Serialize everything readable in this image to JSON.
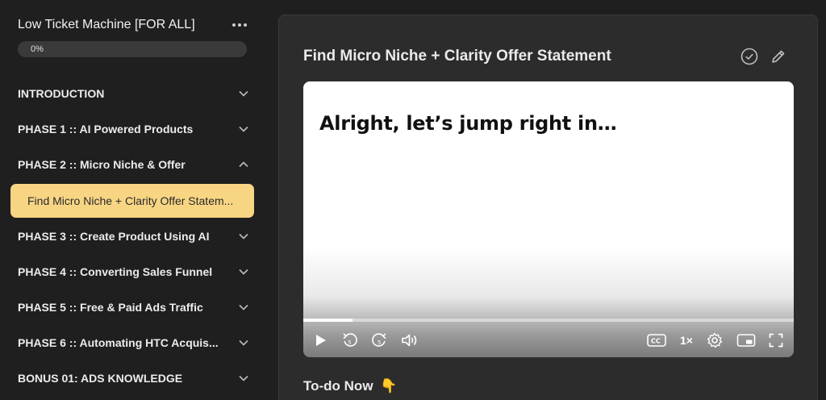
{
  "sidebar": {
    "course_title": "Low Ticket Machine [FOR ALL]",
    "progress_label": "0%",
    "progress": 0,
    "sections": [
      {
        "label": "INTRODUCTION",
        "expanded": false
      },
      {
        "label": "PHASE 1 :: AI Powered Products",
        "expanded": false
      },
      {
        "label": "PHASE 2 :: Micro Niche & Offer",
        "expanded": true
      },
      {
        "label": "PHASE 3 :: Create Product Using AI",
        "expanded": false
      },
      {
        "label": "PHASE 4 :: Converting Sales Funnel",
        "expanded": false
      },
      {
        "label": "PHASE 5 :: Free & Paid Ads Traffic",
        "expanded": false
      },
      {
        "label": "PHASE 6 :: Automating HTC Acquis...",
        "expanded": false
      },
      {
        "label": "BONUS 01: ADS KNOWLEDGE",
        "expanded": false
      }
    ],
    "active_lesson": "Find Micro Niche + Clarity Offer Statem..."
  },
  "main": {
    "lesson_title": "Find Micro Niche + Clarity Offer Statement",
    "video": {
      "heading": "Alright, let’s jump right in…",
      "progress": 0.1,
      "speed_label": "1×"
    },
    "todo_label": "To-do Now",
    "todo_emoji": "👇"
  },
  "colors": {
    "accent": "#f8d583",
    "background": "#1f1f1f",
    "panel": "#2c2c2c"
  },
  "icons": [
    "more-icon",
    "chevron-down-icon",
    "chevron-up-icon",
    "check-circle-icon",
    "pencil-icon",
    "play-icon",
    "rewind-5-icon",
    "forward-5-icon",
    "volume-icon",
    "captions-icon",
    "settings-icon",
    "pip-icon",
    "fullscreen-icon"
  ]
}
